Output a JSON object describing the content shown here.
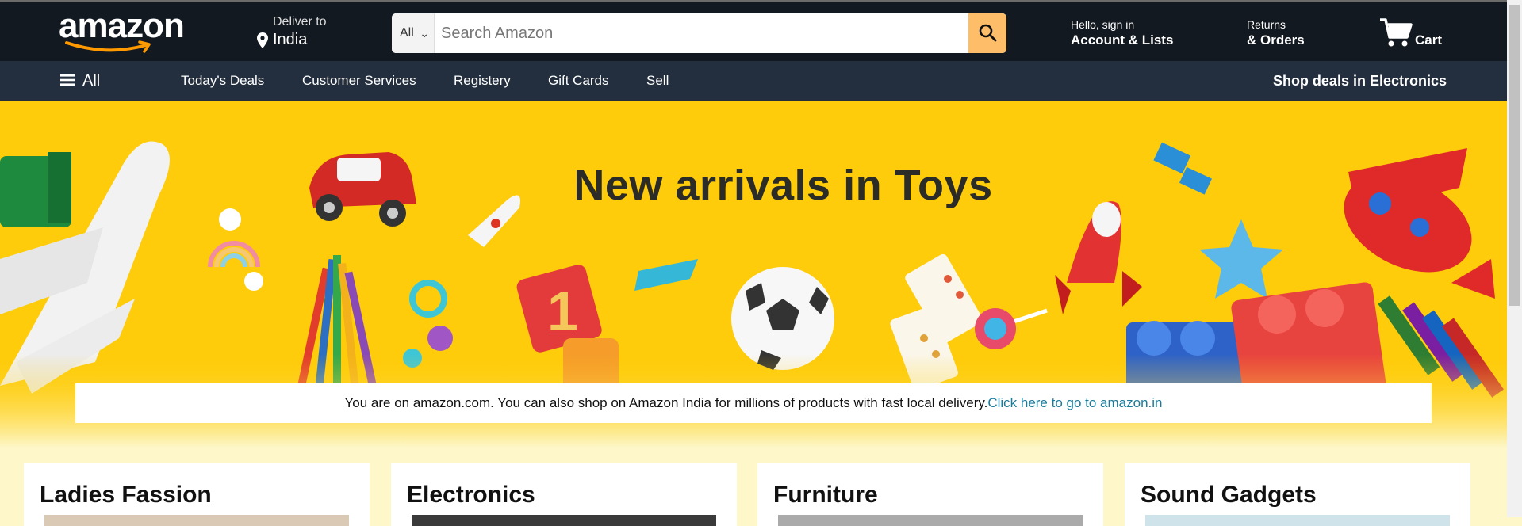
{
  "header": {
    "logo_text": "amazon",
    "deliver_line1": "Deliver to",
    "deliver_line2": "India",
    "search_category": "All",
    "search_placeholder": "Search Amazon",
    "account_line1": "Hello, sign in",
    "account_line2": "Account & Lists",
    "returns_line1": "Returns",
    "returns_line2": "& Orders",
    "cart_label": "Cart"
  },
  "nav": {
    "all_label": "All",
    "items": [
      "Today's Deals",
      "Customer Services",
      "Registery",
      "Gift Cards",
      "Sell"
    ],
    "promo": "Shop deals in Electronics"
  },
  "hero": {
    "title": "New arrivals in Toys",
    "notice_text": "You are on amazon.com. You can also shop on Amazon India for millions of products with fast local delivery.",
    "notice_link": "Click here to go to amazon.in"
  },
  "cards": [
    "Ladies Fassion",
    "Electronics",
    "Furniture",
    "Sound Gadgets"
  ],
  "colors": {
    "header": "#131921",
    "nav": "#232f3e",
    "accent": "#febd69",
    "hero_bg": "#fecc0a",
    "link": "#1b7b9a"
  }
}
